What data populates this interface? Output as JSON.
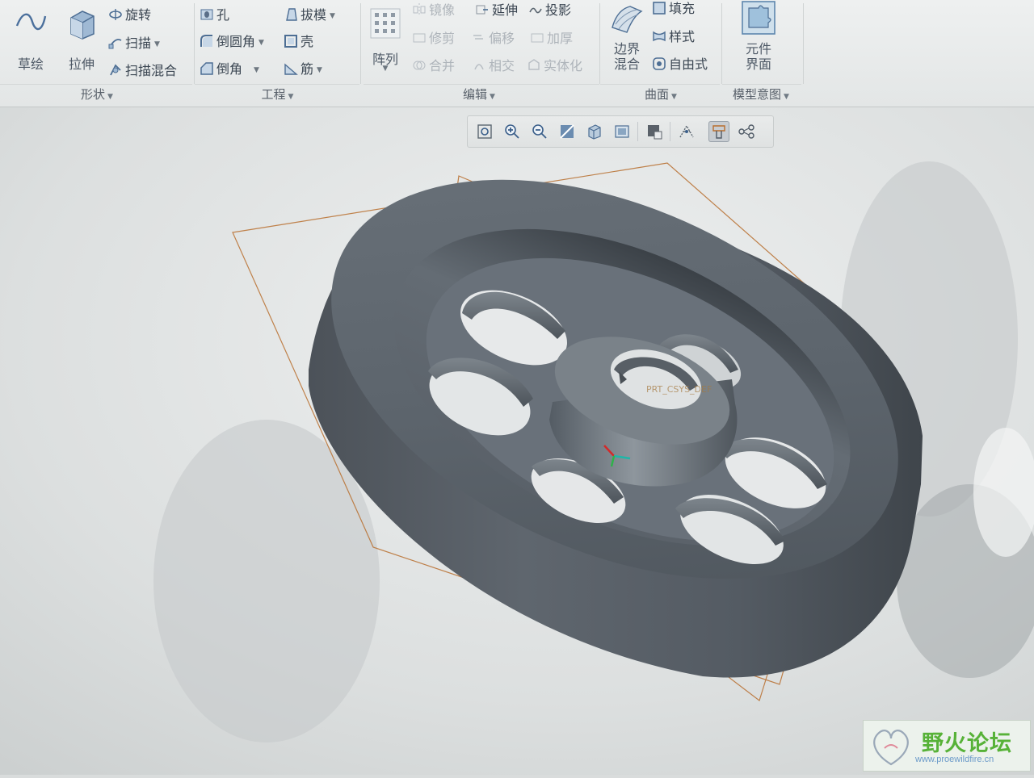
{
  "ribbon": {
    "shape_group": {
      "label": "形状",
      "sketch_label": "草绘",
      "extrude_label": "拉伸",
      "revolve_label": "旋转",
      "sweep_label": "扫描",
      "swept_blend_label": "扫描混合"
    },
    "engineering_group": {
      "label": "工程",
      "hole_label": "孔",
      "round_label": "倒圆角",
      "chamfer_label": "倒角",
      "draft_label": "拔模",
      "shell_label": "壳",
      "rib_label": "筋"
    },
    "pattern_label": "阵列",
    "editing_group": {
      "label": "编辑",
      "mirror_label": "镜像",
      "extend_label": "延伸",
      "project_label": "投影",
      "trim_label": "修剪",
      "offset_label": "偏移",
      "thicken_label": "加厚",
      "merge_label": "合并",
      "intersect_label": "相交",
      "solidify_label": "实体化"
    },
    "surfaces_group": {
      "label": "曲面",
      "boundary_blend_line1": "边界",
      "boundary_blend_line2": "混合",
      "fill_label": "填充",
      "style_label": "样式",
      "freestyle_label": "自由式"
    },
    "model_intent_group": {
      "label": "模型意图",
      "component_interface_line1": "元件",
      "component_interface_line2": "界面"
    }
  },
  "view_toolbar": {
    "icons": [
      "refit-icon",
      "zoom-in-icon",
      "zoom-out-icon",
      "repaint-icon",
      "orientation-icon",
      "saved-views-icon",
      "display-style-icon",
      "view-manager-icon",
      "plane-display-icon",
      "axis-display-icon"
    ],
    "active": "plane-display-icon"
  },
  "model": {
    "shading_color": "#5b636c",
    "datum_plane_color": "#b86e2e",
    "coordinate_system_label": "PRT_CSYS_DEF"
  },
  "watermark": {
    "title": "野火论坛",
    "url": "www.proewildfire.cn"
  },
  "colors": {
    "ribbon_bg": "#e8ebeb",
    "viewport_bg": "#d9dcdc",
    "label_text": "#4e5966",
    "watermark_green": "#57b238"
  }
}
